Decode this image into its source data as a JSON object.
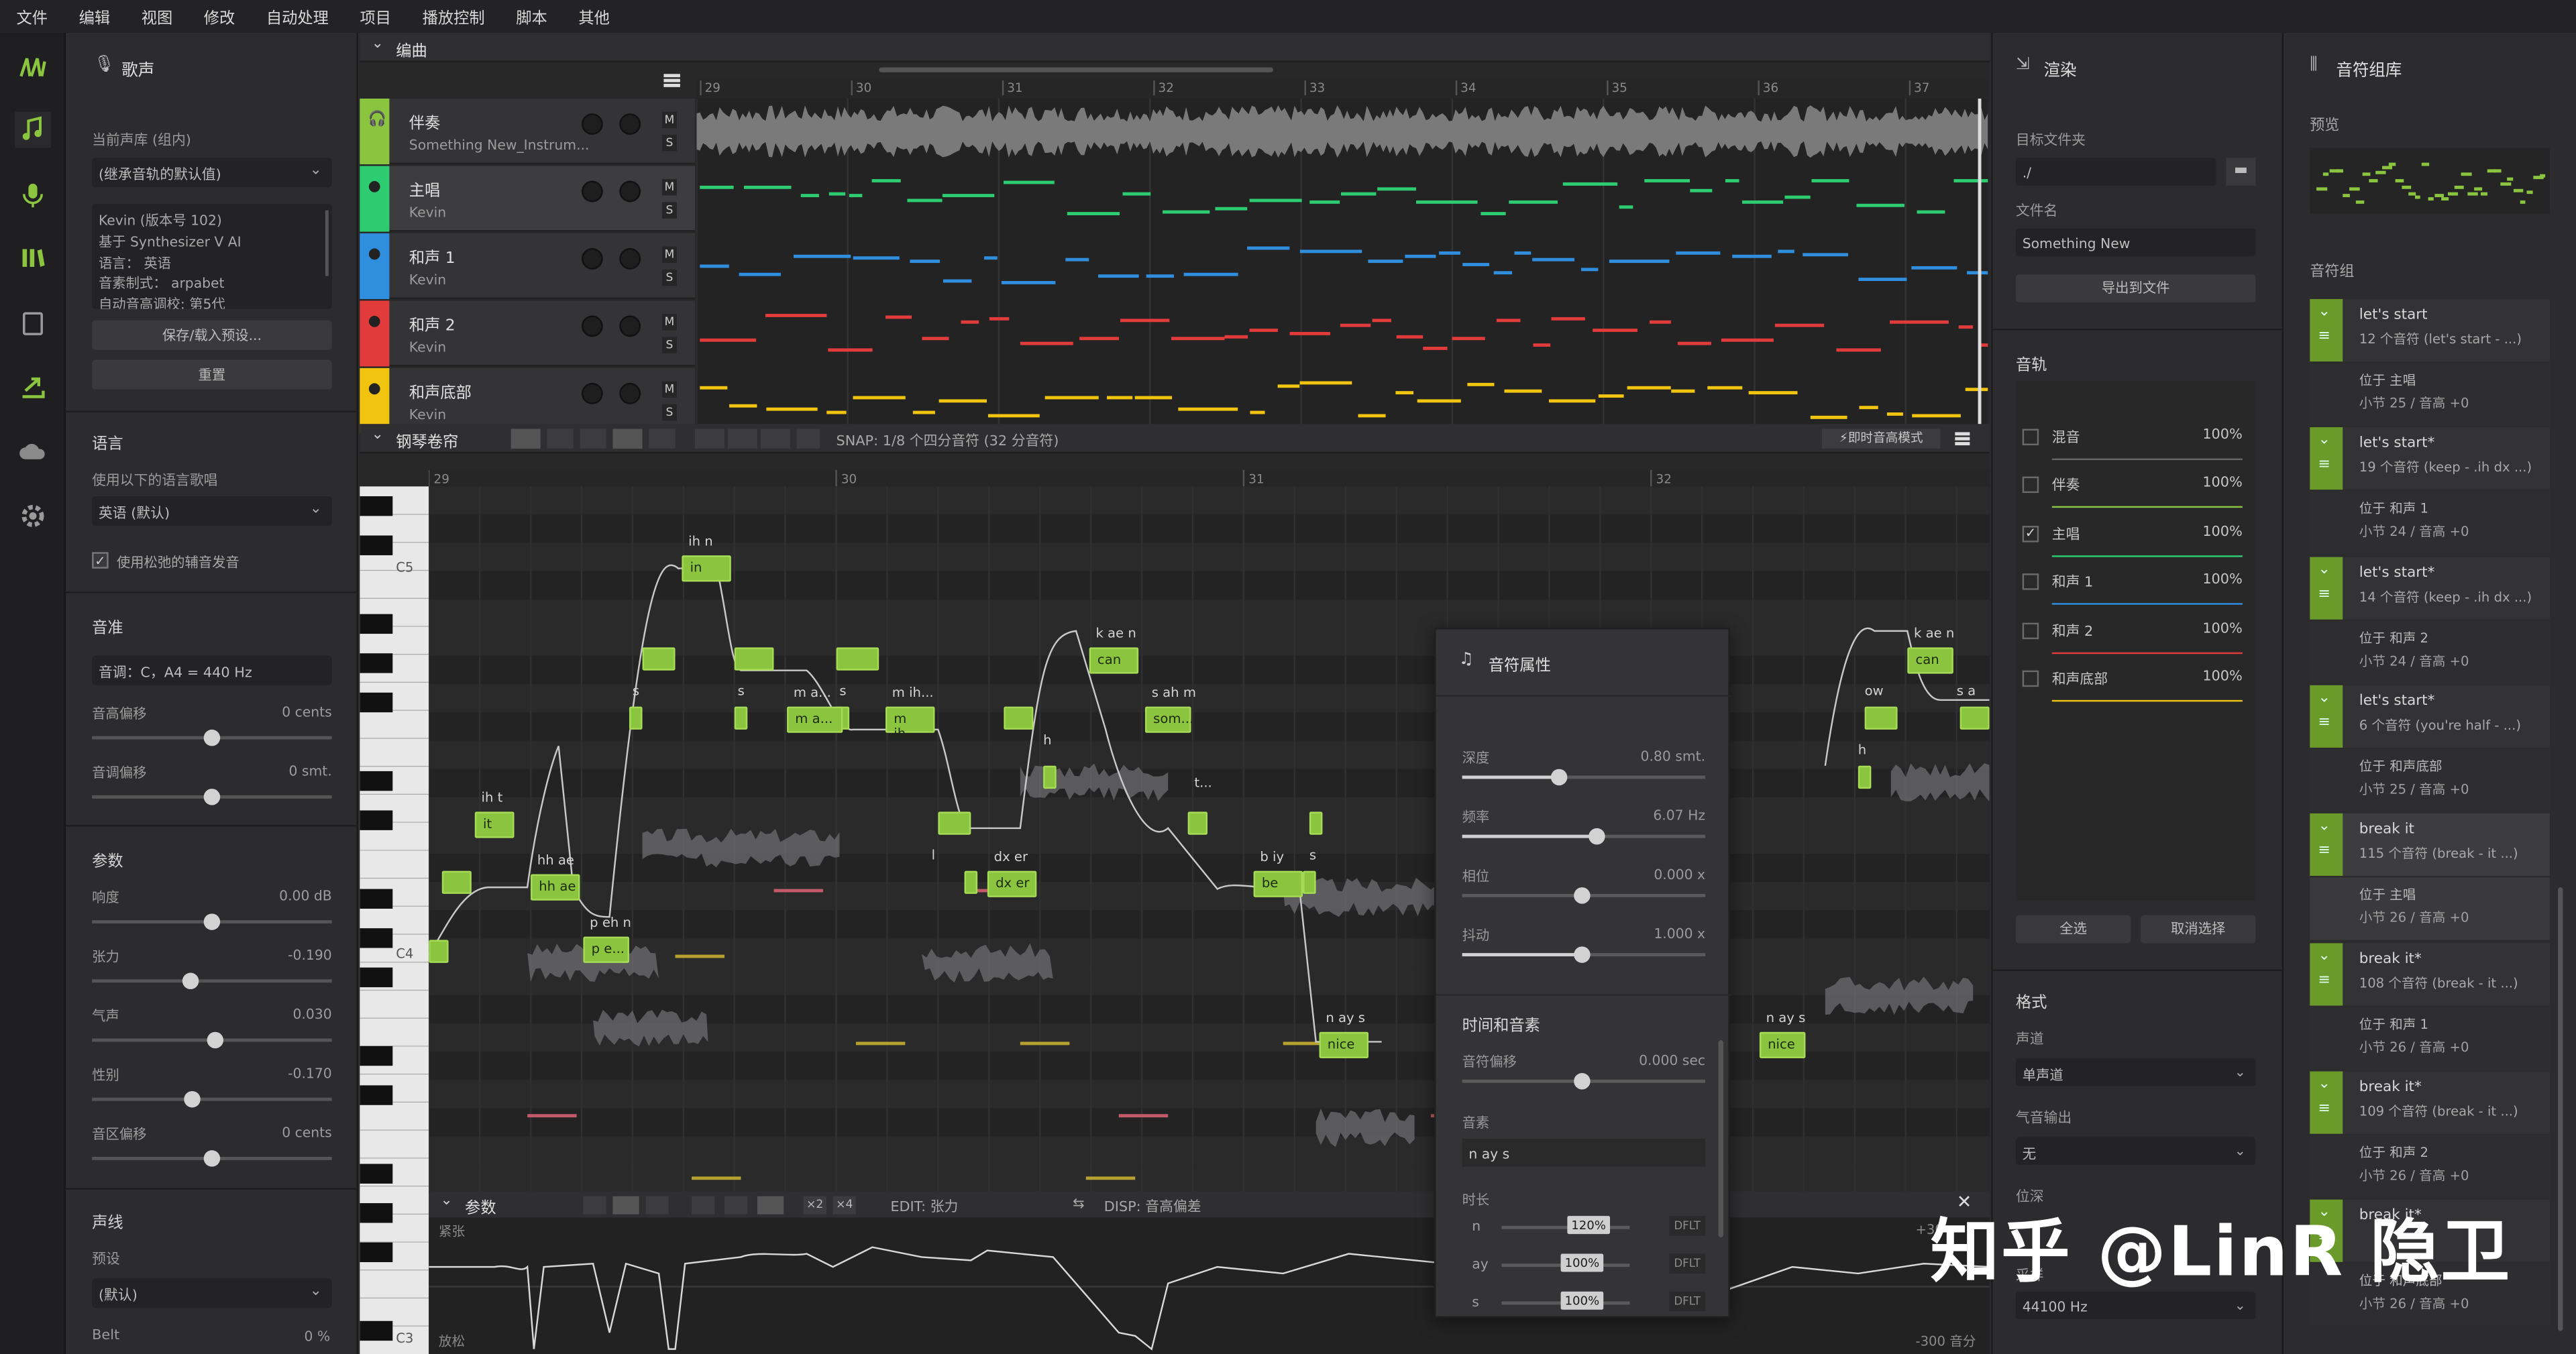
{
  "menu": [
    "文件",
    "编辑",
    "视图",
    "修改",
    "自动处理",
    "项目",
    "播放控制",
    "脚本",
    "其他"
  ],
  "voice": {
    "title": "歌声",
    "db_label": "当前声库 (组内)",
    "db_select": "(继承音轨的默认值)",
    "info": [
      "Kevin (版本号 102)",
      "基于 Synthesizer V AI",
      "语言： 英语",
      "音素制式： arpabet",
      "自动音高调校: 第5代"
    ],
    "save_btn": "保存/载入预设...",
    "reset_btn": "重置",
    "lang_section": "语言",
    "lang_label": "使用以下的语言歌唱",
    "lang_select": "英语 (默认)",
    "loose_label": "使用松弛的辅音发音",
    "pitch_section": "音准",
    "tuning": "音调：C，A4 = 440 Hz",
    "pitch_shift": "音高偏移",
    "pitch_shift_val": "0 cents",
    "tone_shift": "音调偏移",
    "tone_shift_val": "0 smt.",
    "param_section": "参数",
    "params": [
      {
        "name": "响度",
        "val": "0.00 dB"
      },
      {
        "name": "张力",
        "val": "-0.190"
      },
      {
        "name": "气声",
        "val": "0.030"
      },
      {
        "name": "性别",
        "val": "-0.170"
      },
      {
        "name": "音区偏移",
        "val": "0 cents"
      }
    ],
    "vocal_section": "声线",
    "preset_label": "预设",
    "preset_select": "(默认)",
    "belt": "Belt",
    "belt_val": "0 %"
  },
  "arrange": {
    "title": "编曲",
    "bars": [
      "29",
      "30",
      "31",
      "32",
      "33",
      "34",
      "35",
      "36",
      "37"
    ],
    "tracks": [
      {
        "name": "伴奏",
        "sub": "Something New_Instrum...",
        "color": "#8bc53f"
      },
      {
        "name": "主唱",
        "sub": "Kevin",
        "color": "#2ecc71"
      },
      {
        "name": "和声 1",
        "sub": "Kevin",
        "color": "#2f8fde"
      },
      {
        "name": "和声 2",
        "sub": "Kevin",
        "color": "#e23b3b"
      },
      {
        "name": "和声底部",
        "sub": "Kevin",
        "color": "#f1c40f"
      }
    ]
  },
  "piano": {
    "title": "钢琴卷帘",
    "snap": "SNAP:  1/8 个四分音符 (32 分音符)",
    "realtime": "即时音高模式",
    "bars": [
      "29",
      "30",
      "31",
      "32"
    ],
    "keys": [
      "C5",
      "C4",
      "C3"
    ],
    "notes": [
      {
        "t": "in",
        "p": "ih n"
      },
      {
        "t": "it",
        "p": "ih t"
      },
      {
        "t": "hh ae",
        "p": "hh ae"
      },
      {
        "t": "p e...",
        "p": "p eh n"
      },
      {
        "t": "m a...",
        "p": "m a..."
      },
      {
        "t": "m ih...",
        "p": "m ih..."
      },
      {
        "t": "can",
        "p": "k ae n"
      },
      {
        "t": "som...",
        "p": "s ah m"
      },
      {
        "t": "dx er",
        "p": "dx er"
      },
      {
        "t": "be",
        "p": "b iy"
      },
      {
        "t": "nice",
        "p": "n ay s"
      },
      {
        "t": "nice",
        "p": "n ay s"
      },
      {
        "t": "can",
        "p": "k ae n"
      }
    ],
    "extra_lyrics": [
      "s",
      "s",
      "s",
      "h",
      "t...",
      "l",
      "s",
      "ow",
      "s a",
      "h"
    ]
  },
  "props": {
    "title": "音符属性",
    "sliders": [
      {
        "name": "深度",
        "val": "0.80 smt."
      },
      {
        "name": "频率",
        "val": "6.07 Hz"
      },
      {
        "name": "相位",
        "val": "0.000 x"
      },
      {
        "name": "抖动",
        "val": "1.000 x"
      }
    ],
    "time_section": "时间和音素",
    "offset": "音符偏移",
    "offset_val": "0.000 sec",
    "phoneme_label": "音素",
    "phoneme_val": "n ay s",
    "dur_label": "时长",
    "durs": [
      {
        "ph": "n",
        "pct": "120%"
      },
      {
        "ph": "ay",
        "pct": "100%"
      },
      {
        "ph": "s",
        "pct": "100%"
      }
    ],
    "dflt": "DFLT"
  },
  "param": {
    "title": "参数",
    "edit": "EDIT:  张力",
    "disp": "DISP:  音高偏差",
    "top": "紧张",
    "bottom": "放松",
    "range": "-300 音分",
    "range2": "+30"
  },
  "render": {
    "title": "渲染",
    "folder_label": "目标文件夹",
    "folder": "./",
    "file_label": "文件名",
    "file": "Something New",
    "export_btn": "导出到文件",
    "tracks_section": "音轨",
    "tracks": [
      {
        "name": "混音",
        "pct": "100%"
      },
      {
        "name": "伴奏",
        "pct": "100%"
      },
      {
        "name": "主唱",
        "pct": "100%"
      },
      {
        "name": "和声 1",
        "pct": "100%"
      },
      {
        "name": "和声 2",
        "pct": "100%"
      },
      {
        "name": "和声底部",
        "pct": "100%"
      }
    ],
    "select_all": "全选",
    "deselect": "取消选择",
    "format_section": "格式",
    "channel_label": "声道",
    "channel": "单声道",
    "breath_label": "气音输出",
    "breath": "无",
    "depth_label": "位深",
    "rate_label": "采样",
    "rate": "44100 Hz"
  },
  "groups": {
    "title": "音符组库",
    "preview": "预览",
    "section": "音符组",
    "items": [
      {
        "t1": "let's start",
        "t2": "12 个音符 (let's start - ...)",
        "s1": "位于 主唱",
        "s2": "小节 25 / 音高 +0"
      },
      {
        "t1": "let's start*",
        "t2": "19 个音符 (keep - .ih dx ...)",
        "s1": "位于 和声 1",
        "s2": "小节 24 / 音高 +0"
      },
      {
        "t1": "let's start*",
        "t2": "14 个音符 (keep - .ih dx ...)",
        "s1": "位于 和声 2",
        "s2": "小节 24 / 音高 +0"
      },
      {
        "t1": "let's start*",
        "t2": "6 个音符 (you're half - ...)",
        "s1": "位于 和声底部",
        "s2": "小节 25 / 音高 +0"
      },
      {
        "t1": "break it",
        "t2": "115 个音符 (break - it ...)",
        "s1": "位于 主唱",
        "s2": "小节 26 / 音高 +0"
      },
      {
        "t1": "break it*",
        "t2": "108 个音符 (break - it ...)",
        "s1": "位于 和声 1",
        "s2": "小节 26 / 音高 +0"
      },
      {
        "t1": "break it*",
        "t2": "109 个音符 (break - it ...)",
        "s1": "位于 和声 2",
        "s2": "小节 26 / 音高 +0"
      },
      {
        "t1": "break it*",
        "t2": "",
        "s1": "位于 和声底部",
        "s2": "小节 26 / 音高 +0"
      }
    ]
  },
  "watermark": "知乎 @LinR 隐卫"
}
